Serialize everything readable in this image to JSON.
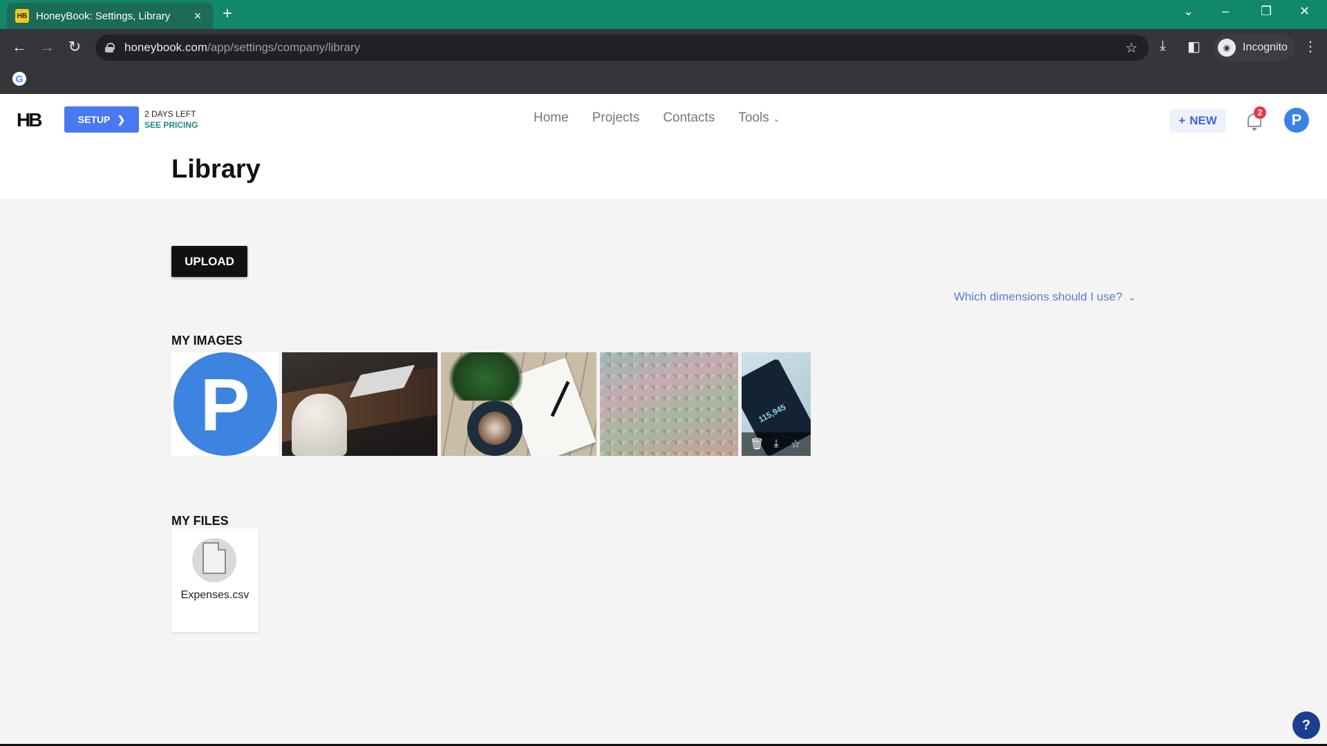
{
  "browser": {
    "tab_title": "HoneyBook: Settings, Library",
    "favicon_label": "HB",
    "url_host": "honeybook.com",
    "url_path": "/app/settings/company/library",
    "profile_label": "Incognito"
  },
  "header": {
    "logo": "HB",
    "setup_label": "SETUP",
    "trial_days": "2 DAYS LEFT",
    "pricing_label": "SEE PRICING",
    "nav": {
      "home": "Home",
      "projects": "Projects",
      "contacts": "Contacts",
      "tools": "Tools"
    },
    "new_label": "NEW",
    "notification_count": "2",
    "avatar_initial": "P"
  },
  "page": {
    "title": "Library",
    "upload_label": "UPLOAD",
    "dimensions_link": "Which dimensions should I use?",
    "my_images_title": "MY IMAGES",
    "my_files_title": "MY FILES",
    "avatar_image_letter": "P",
    "phone_screen_text": "115,945",
    "files": [
      {
        "name": "Expenses.csv"
      }
    ]
  },
  "help_label": "?",
  "colors": {
    "tabbar": "#11876b",
    "setup_button": "#4a78f0",
    "upload_button": "#111111",
    "link": "#5a7bd0",
    "badge": "#e53945"
  }
}
